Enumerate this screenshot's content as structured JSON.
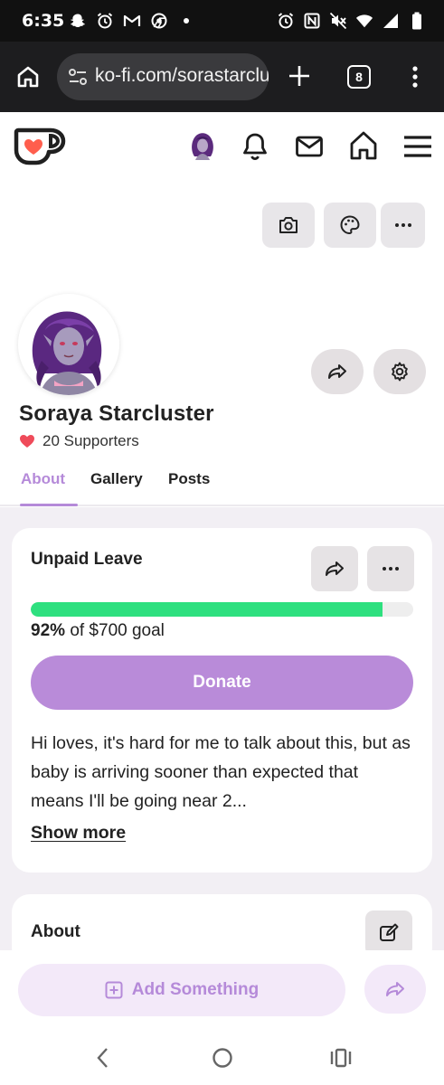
{
  "status_bar": {
    "time": "6:35",
    "left_icons": [
      "snapchat-icon",
      "alarm-icon",
      "gmail-icon",
      "chrome-icon",
      "dot-icon"
    ],
    "right_icons": [
      "alarm-icon",
      "nfc-icon",
      "mute-icon",
      "wifi-icon",
      "signal-icon",
      "battery-icon"
    ]
  },
  "browser": {
    "url": "ko-fi.com/sorastarcluster",
    "tab_count": "8"
  },
  "header": {
    "icons": [
      "kofi-logo",
      "avatar",
      "bell-icon",
      "mail-icon",
      "home-icon",
      "hamburger-icon"
    ]
  },
  "profile": {
    "name": "Soraya Starcluster",
    "supporters": "20 Supporters",
    "tabs": [
      {
        "label": "About",
        "active": true
      },
      {
        "label": "Gallery",
        "active": false
      },
      {
        "label": "Posts",
        "active": false
      }
    ]
  },
  "goal_card": {
    "title": "Unpaid Leave",
    "progress_fraction": 0.92,
    "goal_percent": "92%",
    "goal_suffix": "of $700 goal",
    "donate_label": "Donate",
    "description": "Hi loves, it's hard for me to talk about this, but as baby is arriving sooner than expected that means I'll be going near 2...",
    "show_more_label": "Show more"
  },
  "about_card": {
    "title": "About"
  },
  "bottom": {
    "add_label": "Add Something"
  },
  "colors": {
    "accent": "#b58ad9",
    "progress": "#2ee07f",
    "kofi_orange": "#ff5e4d"
  }
}
